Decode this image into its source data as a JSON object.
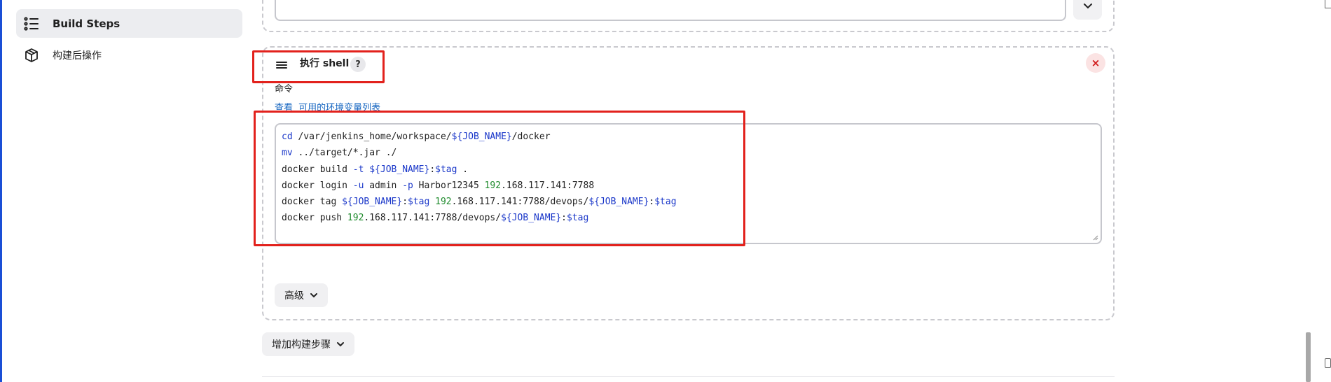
{
  "sidebar": {
    "items": [
      {
        "label": "Build Steps",
        "icon": "list-steps-icon",
        "active": true
      },
      {
        "label": "构建后操作",
        "icon": "package-icon",
        "active": false
      }
    ]
  },
  "step": {
    "title": "执行 shell",
    "help": "?",
    "close": "×",
    "command_label": "命令",
    "env_prefix": "查看",
    "env_link": "可用的环境变量列表",
    "code_lines": [
      [
        [
          "kw",
          "cd"
        ],
        [
          "t",
          " /var/jenkins_home/workspace/"
        ],
        [
          "var",
          "${JOB_NAME}"
        ],
        [
          "t",
          "/docker"
        ]
      ],
      [
        [
          "kw",
          "mv"
        ],
        [
          "t",
          " ../target/*.jar ./"
        ]
      ],
      [
        [
          "t",
          "docker build "
        ],
        [
          "kw",
          "-t"
        ],
        [
          "t",
          " "
        ],
        [
          "var",
          "${JOB_NAME}"
        ],
        [
          "t",
          ":"
        ],
        [
          "var",
          "$tag"
        ],
        [
          "t",
          " ."
        ]
      ],
      [
        [
          "t",
          "docker login "
        ],
        [
          "kw",
          "-u"
        ],
        [
          "t",
          " admin "
        ],
        [
          "kw",
          "-p"
        ],
        [
          "t",
          " Harbor12345 "
        ],
        [
          "num",
          "192"
        ],
        [
          "t",
          ".168.117.141:7788"
        ]
      ],
      [
        [
          "t",
          "docker tag "
        ],
        [
          "var",
          "${JOB_NAME}"
        ],
        [
          "t",
          ":"
        ],
        [
          "var",
          "$tag"
        ],
        [
          "t",
          " "
        ],
        [
          "num",
          "192"
        ],
        [
          "t",
          ".168.117.141:7788/devops/"
        ],
        [
          "var",
          "${JOB_NAME}"
        ],
        [
          "t",
          ":"
        ],
        [
          "var",
          "$tag"
        ]
      ],
      [
        [
          "t",
          "docker push "
        ],
        [
          "num",
          "192"
        ],
        [
          "t",
          ".168.117.141:7788/devops/"
        ],
        [
          "var",
          "${JOB_NAME}"
        ],
        [
          "t",
          ":"
        ],
        [
          "var",
          "$tag"
        ]
      ]
    ],
    "advanced_label": "高级"
  },
  "add_step_label": "增加构建步骤",
  "colors": {
    "accent": "#1a4fd6",
    "highlight_box": "#e2211c",
    "keyword": "#1a37c9",
    "number": "#1d8a2b",
    "link": "#1565c0"
  }
}
